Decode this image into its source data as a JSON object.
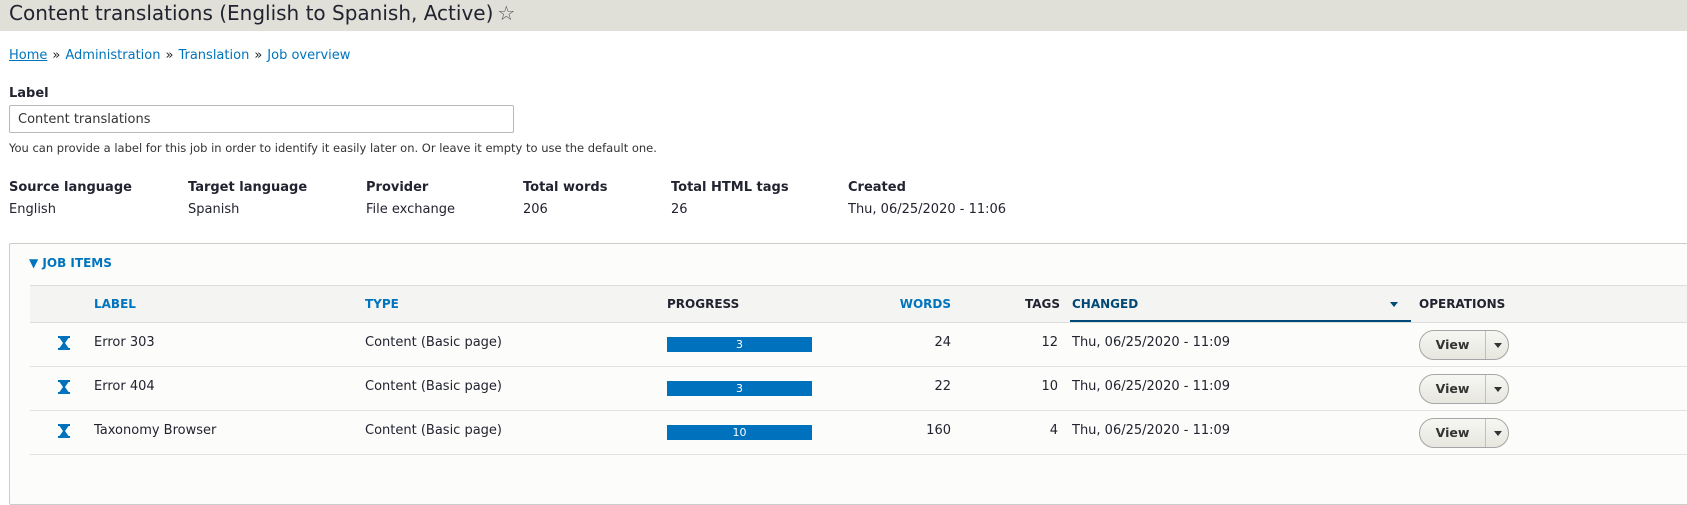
{
  "page": {
    "title": "Content translations (English to Spanish, Active)",
    "star_icon": "☆"
  },
  "breadcrumb": [
    "Home",
    "Administration",
    "Translation",
    "Job overview"
  ],
  "breadcrumb_separator": "»",
  "label_field": {
    "label": "Label",
    "value": "Content translations",
    "help": "You can provide a label for this job in order to identify it easily later on. Or leave it empty to use the default one."
  },
  "job_meta": [
    {
      "label": "Source language",
      "value": "English"
    },
    {
      "label": "Target language",
      "value": "Spanish"
    },
    {
      "label": "Provider",
      "value": "File exchange"
    },
    {
      "label": "Total words",
      "value": "206"
    },
    {
      "label": "Total HTML tags",
      "value": "26"
    },
    {
      "label": "Created",
      "value": "Thu, 06/25/2020 - 11:06"
    }
  ],
  "job_items": {
    "toggle": "▼",
    "title": "JOB ITEMS",
    "columns": {
      "label": "LABEL",
      "type": "TYPE",
      "progress": "PROGRESS",
      "words": "WORDS",
      "tags": "TAGS",
      "changed": "CHANGED",
      "operations": "OPERATIONS"
    },
    "rows": [
      {
        "label": "Error 303",
        "type": "Content (Basic page)",
        "progress": "3",
        "words": "24",
        "tags": "12",
        "changed": "Thu, 06/25/2020 - 11:09",
        "op": "View",
        "status_icon": "hourglass-icon"
      },
      {
        "label": "Error 404",
        "type": "Content (Basic page)",
        "progress": "3",
        "words": "22",
        "tags": "10",
        "changed": "Thu, 06/25/2020 - 11:09",
        "op": "View",
        "status_icon": "hourglass-icon"
      },
      {
        "label": "Taxonomy Browser",
        "type": "Content (Basic page)",
        "progress": "10",
        "words": "160",
        "tags": "4",
        "changed": "Thu, 06/25/2020 - 11:09",
        "op": "View",
        "status_icon": "hourglass-icon"
      }
    ]
  },
  "colors": {
    "link": "#0074bd",
    "progress_bar": "#0071bc",
    "header_bg": "#e0e0d8"
  }
}
